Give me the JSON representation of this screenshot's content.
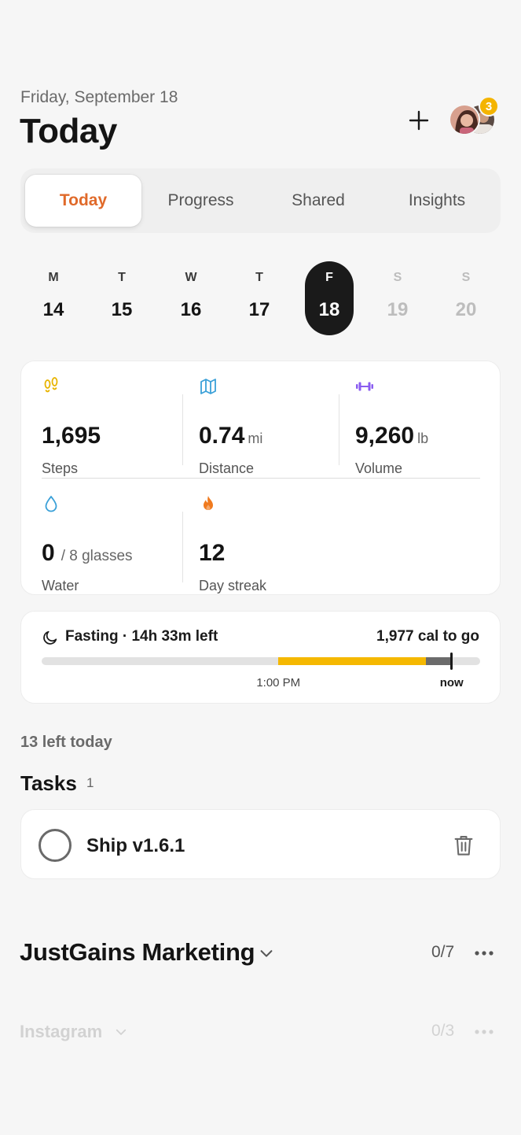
{
  "header": {
    "date": "Friday, September 18",
    "title": "Today",
    "notification_count": "3"
  },
  "tabs": [
    {
      "label": "Today",
      "active": true
    },
    {
      "label": "Progress",
      "active": false
    },
    {
      "label": "Shared",
      "active": false
    },
    {
      "label": "Insights",
      "active": false
    }
  ],
  "week": [
    {
      "letter": "M",
      "num": "14"
    },
    {
      "letter": "T",
      "num": "15"
    },
    {
      "letter": "W",
      "num": "16"
    },
    {
      "letter": "T",
      "num": "17"
    },
    {
      "letter": "F",
      "num": "18"
    },
    {
      "letter": "S",
      "num": "19"
    },
    {
      "letter": "S",
      "num": "20"
    }
  ],
  "stats": {
    "steps": {
      "value": "1,695",
      "label": "Steps"
    },
    "distance": {
      "value": "0.74",
      "unit": "mi",
      "label": "Distance"
    },
    "volume": {
      "value": "9,260",
      "unit": "lb",
      "label": "Volume"
    },
    "water": {
      "value": "0",
      "unit": "/ 8 glasses",
      "label": "Water"
    },
    "streak": {
      "value": "12",
      "label": "Day streak"
    }
  },
  "fasting": {
    "title": "Fasting · 14h 33m left",
    "calories": "1,977 cal to go",
    "start_label": "1:00 PM",
    "now_label": "now",
    "start_fraction": 0.54,
    "eaten_end_fraction": 0.876,
    "now_fraction": 0.935
  },
  "tasks": {
    "left_today": "13 left today",
    "title": "Tasks",
    "count": "1",
    "items": [
      {
        "label": "Ship v1.6.1"
      }
    ]
  },
  "project": {
    "title": "JustGains Marketing",
    "count": "0/7"
  },
  "subproject": {
    "title": "Instagram",
    "count": "0/3"
  },
  "colors": {
    "accent": "#e06a2a",
    "fasting_bar": "#f5b800",
    "badge": "#f4b400",
    "steps_icon": "#e8b400",
    "distance_icon": "#3aa0d8",
    "volume_icon": "#8a5cf0",
    "water_icon": "#3aa0d8",
    "streak_icon": "#f07a1e"
  }
}
